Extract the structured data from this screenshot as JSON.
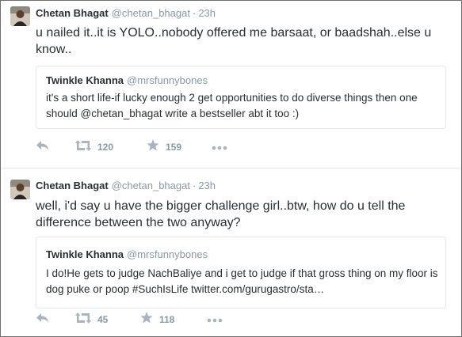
{
  "tweets": [
    {
      "author_name": "Chetan Bhagat",
      "author_handle": "@chetan_bhagat",
      "time": "23h",
      "text": "u nailed it..it is YOLO..nobody offered me barsaat, or baadshah..else u know..",
      "quote": {
        "author_name": "Twinkle Khanna",
        "author_handle": "@mrsfunnybones",
        "text": "it's a short life-if lucky enough 2 get opportunities to do diverse things then one should @chetan_bhagat write a bestseller abt it too :)"
      },
      "retweets": "120",
      "favorites": "159"
    },
    {
      "author_name": "Chetan Bhagat",
      "author_handle": "@chetan_bhagat",
      "time": "23h",
      "text": "well, i'd say u have the bigger challenge girl..btw, how do u tell the difference between the two anyway?",
      "quote": {
        "author_name": "Twinkle Khanna",
        "author_handle": "@mrsfunnybones",
        "text": "I do!He gets to judge NachBaliye and i get  to judge if that gross thing on my floor is dog puke or poop #SuchIsLife twitter.com/gurugastro/sta…"
      },
      "retweets": "45",
      "favorites": "118"
    }
  ],
  "separator": "·",
  "icons": {
    "reply": "reply-arrow-icon",
    "retweet": "retweet-icon",
    "favorite": "star-icon",
    "more": "more-dots-icon"
  },
  "colors": {
    "text": "#292f33",
    "muted": "#8899a6",
    "border": "#e1e8ed"
  }
}
